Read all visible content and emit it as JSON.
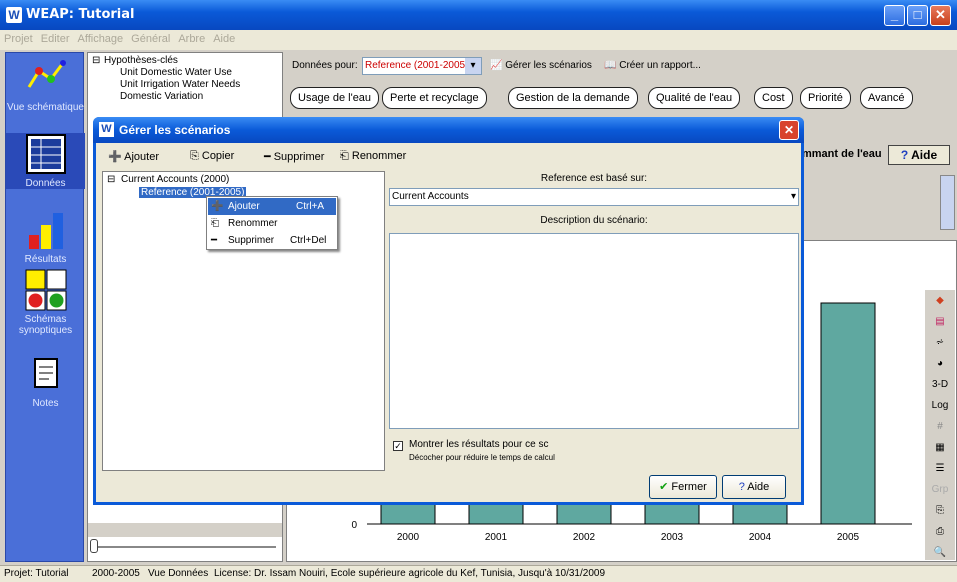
{
  "app": {
    "title": "WEAP: Tutorial",
    "icon_letter": "W"
  },
  "menu": [
    "Projet",
    "Editer",
    "Affichage",
    "Général",
    "Arbre",
    "Aide"
  ],
  "sidebar": [
    {
      "label": "Vue schématique",
      "icon": "schematic-icon"
    },
    {
      "label": "Données",
      "icon": "data-icon"
    },
    {
      "label": "Résultats",
      "icon": "results-icon"
    },
    {
      "label": "Schémas synoptiques",
      "icon": "overviews-icon"
    },
    {
      "label": "Notes",
      "icon": "notes-icon"
    }
  ],
  "tree": {
    "root": "Hypothèses-clés",
    "children": [
      "Unit Domestic Water Use",
      "Unit Irrigation Water Needs",
      "Domestic Variation"
    ]
  },
  "data_bar": {
    "label": "Données pour:",
    "scenario": "Reference (2001-2005)",
    "manage": "Gérer les scénarios",
    "report": "Créer un rapport..."
  },
  "tabs": [
    "Usage de l'eau",
    "Perte et recyclage",
    "Gestion de la demande",
    "Qualité de l'eau",
    "Cost",
    "Priorité",
    "Avancé"
  ],
  "bg_header": "mmant de l'eau",
  "help": "Aide",
  "dialog": {
    "title": "Gérer les scénarios",
    "toolbar": [
      "Ajouter",
      "Copier",
      "Supprimer",
      "Renommer"
    ],
    "tree_root": "Current Accounts (2000)",
    "tree_child": "Reference (2001-2005)",
    "based_on_label": "Reference est basé sur:",
    "based_on_value": "Current Accounts",
    "desc_label": "Description du scénario:",
    "show_results": "Montrer les résultats pour ce sc",
    "uncheck_note": "Décocher pour réduire le temps de calcul",
    "close": "Fermer",
    "help": "Aide"
  },
  "context_menu": [
    {
      "label": "Ajouter",
      "shortcut": "Ctrl+A"
    },
    {
      "label": "Renommer",
      "shortcut": ""
    },
    {
      "label": "Supprimer",
      "shortcut": "Ctrl+Del"
    }
  ],
  "chart_data": {
    "type": "bar",
    "categories": [
      "2000",
      "2001",
      "2002",
      "2003",
      "2004",
      "2005"
    ],
    "y_tick": "0",
    "color": "#5fa8a0"
  },
  "right_tools": [
    "3-D",
    "Log",
    "Grp"
  ],
  "status": {
    "project": "Projet: Tutorial",
    "years": "2000-2005",
    "view": "Vue Données",
    "license": "License: Dr. Issam Nouiri, Ecole supérieure agricole du Kef, Tunisia, Jusqu'à 10/31/2009"
  }
}
